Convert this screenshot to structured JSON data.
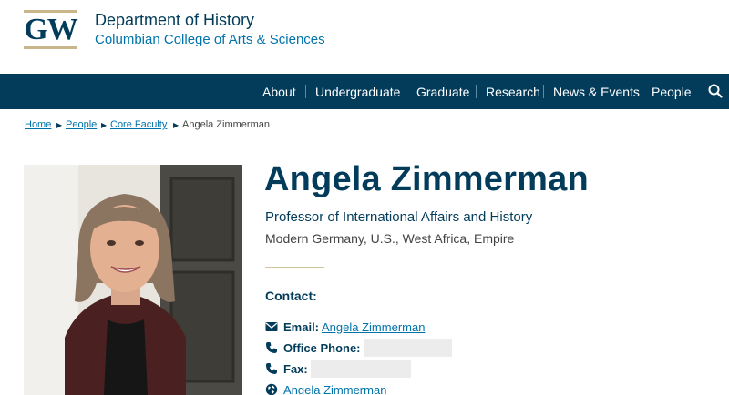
{
  "header": {
    "logo_text": "GW",
    "department": "Department of History",
    "college": "Columbian College of Arts & Sciences",
    "brand_colors": {
      "navy": "#033c5a",
      "gold": "#c8b58a",
      "link": "#0073aa"
    }
  },
  "nav": {
    "items": [
      {
        "label": "About"
      },
      {
        "label": "Undergraduate"
      },
      {
        "label": "Graduate"
      },
      {
        "label": "Research"
      },
      {
        "label": "News & Events"
      },
      {
        "label": "People"
      }
    ],
    "search_icon": "search-icon"
  },
  "breadcrumb": {
    "items": [
      "Home",
      "People",
      "Core Faculty"
    ],
    "current": "Angela Zimmerman"
  },
  "profile": {
    "name": "Angela Zimmerman",
    "title": "Professor of International Affairs and History",
    "fields": "Modern Germany, U.S., West Africa, Empire",
    "contact_heading": "Contact:",
    "email_label": "Email:",
    "email_link": "Angela Zimmerman",
    "phone_label": "Office Phone:",
    "fax_label": "Fax:",
    "website_link": "Angela Zimmerman"
  }
}
